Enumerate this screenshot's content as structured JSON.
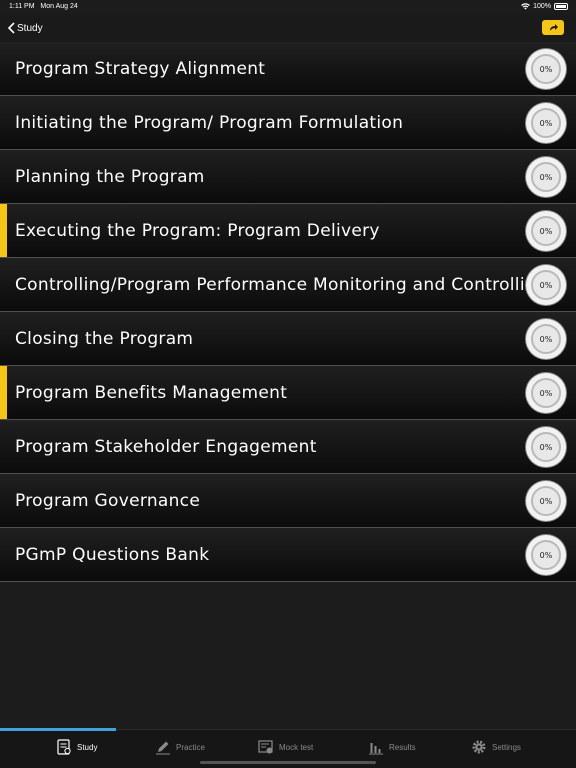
{
  "status_bar": {
    "time": "1:11 PM",
    "date": "Mon Aug 24",
    "battery": "100%"
  },
  "nav": {
    "back_label": "Study",
    "share_icon": "share-arrow-icon",
    "accent": "#f5c518"
  },
  "topics": [
    {
      "title": "Program Strategy Alignment",
      "progress": "0%",
      "highlighted": false
    },
    {
      "title": "Initiating the Program/ Program Formulation",
      "progress": "0%",
      "highlighted": false
    },
    {
      "title": "Planning the Program",
      "progress": "0%",
      "highlighted": false
    },
    {
      "title": "Executing the Program: Program Delivery",
      "progress": "0%",
      "highlighted": true
    },
    {
      "title": "Controlling/Program Performance Monitoring and Controlling",
      "progress": "0%",
      "highlighted": false
    },
    {
      "title": "Closing the Program",
      "progress": "0%",
      "highlighted": false
    },
    {
      "title": "Program Benefits Management",
      "progress": "0%",
      "highlighted": true
    },
    {
      "title": "Program Stakeholder Engagement",
      "progress": "0%",
      "highlighted": false
    },
    {
      "title": "Program Governance",
      "progress": "0%",
      "highlighted": false
    },
    {
      "title": "PGmP Questions Bank",
      "progress": "0%",
      "highlighted": false
    }
  ],
  "tabs": [
    {
      "label": "Study",
      "icon": "study-icon",
      "active": true
    },
    {
      "label": "Practice",
      "icon": "pencil-icon",
      "active": false
    },
    {
      "label": "Mock test",
      "icon": "mock-test-icon",
      "active": false
    },
    {
      "label": "Results",
      "icon": "bar-chart-icon",
      "active": false
    },
    {
      "label": "Settings",
      "icon": "gear-icon",
      "active": false
    }
  ]
}
